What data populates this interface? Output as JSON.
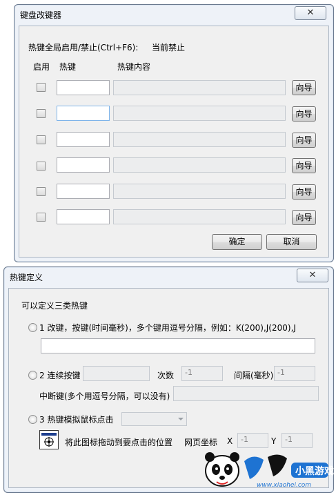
{
  "window1": {
    "title": "键盘改键器",
    "close_glyph": "✕",
    "status_label": "热键全局启用/禁止(Ctrl+F6):",
    "status_value": "当前禁止",
    "col_enable": "启用",
    "col_hotkey": "热键",
    "col_content": "热键内容",
    "rows": [
      {
        "hotkey": "",
        "content": "",
        "wizard": "向导"
      },
      {
        "hotkey": "",
        "content": "",
        "wizard": "向导"
      },
      {
        "hotkey": "",
        "content": "",
        "wizard": "向导"
      },
      {
        "hotkey": "",
        "content": "",
        "wizard": "向导"
      },
      {
        "hotkey": "",
        "content": "",
        "wizard": "向导"
      },
      {
        "hotkey": "",
        "content": "",
        "wizard": "向导"
      }
    ],
    "ok_label": "确定",
    "cancel_label": "取消"
  },
  "window2": {
    "title": "热键定义",
    "close_glyph": "✕",
    "intro": "可以定义三类热键",
    "opt1_label": "1 改键，按键(时间毫秒)，多个键用逗号分隔，例如：K(200),J(200),J",
    "opt1_value": "",
    "opt2_label": "2 连续按键",
    "count_label": "次数",
    "count_value": "-1",
    "interval_label": "间隔(毫秒)",
    "interval_value": "-1",
    "break_label": "中断键(多个用逗号分隔，可以没有)",
    "break_value": "",
    "opt3_label": "3 热键模拟鼠标点击",
    "drag_hint": "将此图标拖动到要点击的位置",
    "coord_label": "网页坐标",
    "x_label": "X",
    "x_value": "-1",
    "y_label": "Y",
    "y_value": "-1"
  },
  "watermark": {
    "text": "小黑游戏",
    "url": "www.xiaohei.com"
  },
  "colors": {
    "frame": "#eef2f8",
    "panel": "#f0f0f0",
    "disabled_field": "#ecedee",
    "focus_border": "#7eb4ea"
  }
}
